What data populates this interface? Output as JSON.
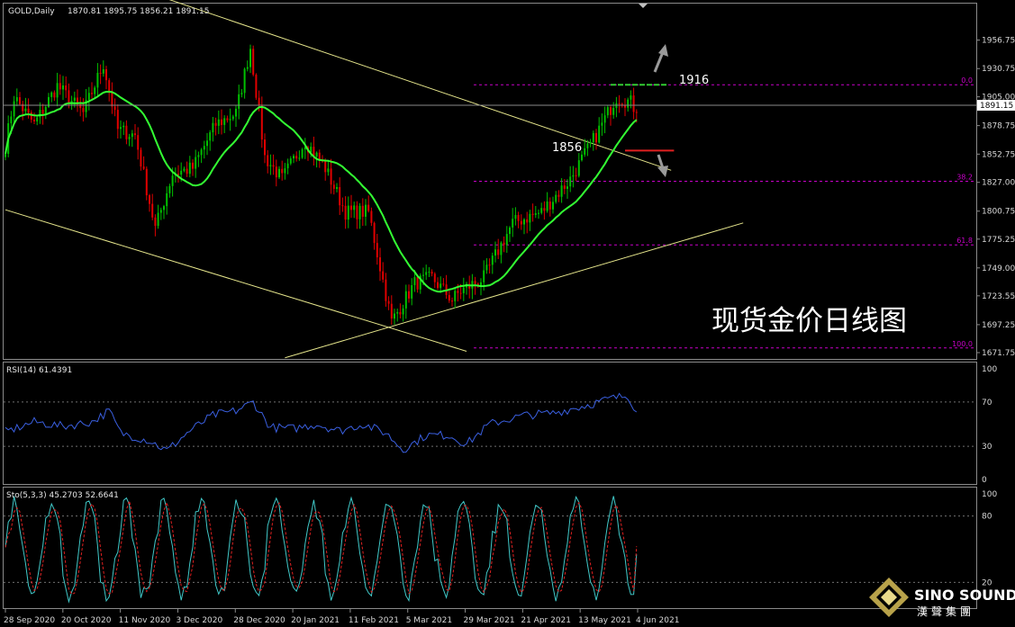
{
  "header": {
    "symbol": "GOLD,Daily",
    "ohlc": "1870.81 1895.75 1856.21 1891.15",
    "rsi_label": "RSI(14) 61.4391",
    "sto_label": "Sto(5,3,3) 45.2703 52.6641"
  },
  "annotations": {
    "level_high": "1916",
    "level_low": "1856",
    "caption": "现货金价日线图",
    "current_price_tag": "1891.15"
  },
  "fib_levels": [
    {
      "label": "0.0",
      "price": 1916
    },
    {
      "label": "38.2",
      "price": 1828
    },
    {
      "label": "61.8",
      "price": 1770
    },
    {
      "label": "100.0",
      "price": 1676
    }
  ],
  "logo": {
    "name": "SINO SOUND",
    "sub": "漢聲集團"
  },
  "colors": {
    "background": "#000000",
    "bull": "#00c000",
    "bear": "#e00000",
    "ma": "#33ff33",
    "trend": "#e6e68c",
    "fib": "#c800c8",
    "rsi": "#3a5fe0",
    "sto_main": "#40c8c8",
    "sto_signal": "#e02020",
    "arrow": "#9a9a9a",
    "marker_green": "#33cc33",
    "marker_red": "#e02020"
  },
  "chart_data": [
    {
      "type": "line",
      "title": "GOLD,Daily",
      "y_ticks": [
        "1956.75",
        "1930.75",
        "1905.00",
        "1878.75",
        "1852.75",
        "1827.00",
        "1800.75",
        "1775.25",
        "1749.00",
        "1723.55",
        "1697.25",
        "1671.75"
      ],
      "ylim": [
        1666,
        1990
      ],
      "x_ticks": [
        "28 Sep 2020",
        "20 Oct 2020",
        "11 Nov 2020",
        "3 Dec 2020",
        "28 Dec 2020",
        "20 Jan 2021",
        "11 Feb 2021",
        "5 Mar 2021",
        "29 Mar 2021",
        "21 Apr 2021",
        "13 May 2021",
        "4 Jun 2021"
      ],
      "x_index_range": [
        0,
        175
      ],
      "close_keypoints": [
        {
          "i": 0,
          "v": 1860
        },
        {
          "i": 3,
          "v": 1905
        },
        {
          "i": 10,
          "v": 1880
        },
        {
          "i": 18,
          "v": 1915
        },
        {
          "i": 27,
          "v": 1890
        },
        {
          "i": 34,
          "v": 1935
        },
        {
          "i": 39,
          "v": 1875
        },
        {
          "i": 45,
          "v": 1870
        },
        {
          "i": 52,
          "v": 1785
        },
        {
          "i": 58,
          "v": 1835
        },
        {
          "i": 65,
          "v": 1840
        },
        {
          "i": 73,
          "v": 1880
        },
        {
          "i": 80,
          "v": 1890
        },
        {
          "i": 85,
          "v": 1950
        },
        {
          "i": 90,
          "v": 1850
        },
        {
          "i": 96,
          "v": 1830
        },
        {
          "i": 104,
          "v": 1865
        },
        {
          "i": 111,
          "v": 1840
        },
        {
          "i": 118,
          "v": 1800
        },
        {
          "i": 126,
          "v": 1800
        },
        {
          "i": 134,
          "v": 1700
        },
        {
          "i": 142,
          "v": 1735
        },
        {
          "i": 148,
          "v": 1740
        },
        {
          "i": 155,
          "v": 1720
        },
        {
          "i": 158,
          "v": 1728
        },
        {
          "i": 166,
          "v": 1740
        },
        {
          "i": 176,
          "v": 1790
        },
        {
          "i": 186,
          "v": 1800
        },
        {
          "i": 196,
          "v": 1830
        },
        {
          "i": 205,
          "v": 1870
        },
        {
          "i": 212,
          "v": 1905
        },
        {
          "i": 217,
          "v": 1900
        },
        {
          "i": 219,
          "v": 1891
        }
      ],
      "moving_average": true,
      "trend_lines": [
        {
          "from": {
            "i": 0,
            "v": 1802
          },
          "to": {
            "i": 160,
            "v": 1673
          }
        },
        {
          "from": {
            "i": 52,
            "v": 1998
          },
          "to": {
            "i": 231,
            "v": 1838
          }
        },
        {
          "from": {
            "i": 97,
            "v": 1667
          },
          "to": {
            "i": 256,
            "v": 1790
          }
        }
      ],
      "markers": [
        {
          "name": "high-marker",
          "from_i": 210,
          "to_i": 230,
          "v": 1916
        },
        {
          "name": "low-marker",
          "from_i": 215,
          "to_i": 232,
          "v": 1856
        }
      ]
    },
    {
      "type": "line",
      "title": "RSI(14) 61.4391",
      "y_ticks": [
        "100",
        "70",
        "30",
        "0"
      ],
      "ylim": [
        0,
        100
      ],
      "series": [
        {
          "name": "RSI(14)",
          "keypoints": [
            {
              "i": 0,
              "v": 43
            },
            {
              "i": 10,
              "v": 52
            },
            {
              "i": 20,
              "v": 48
            },
            {
              "i": 30,
              "v": 52
            },
            {
              "i": 36,
              "v": 62
            },
            {
              "i": 40,
              "v": 42
            },
            {
              "i": 50,
              "v": 35
            },
            {
              "i": 56,
              "v": 26
            },
            {
              "i": 64,
              "v": 44
            },
            {
              "i": 72,
              "v": 58
            },
            {
              "i": 80,
              "v": 62
            },
            {
              "i": 86,
              "v": 70
            },
            {
              "i": 92,
              "v": 47
            },
            {
              "i": 100,
              "v": 46
            },
            {
              "i": 108,
              "v": 50
            },
            {
              "i": 116,
              "v": 44
            },
            {
              "i": 124,
              "v": 50
            },
            {
              "i": 132,
              "v": 42
            },
            {
              "i": 138,
              "v": 27
            },
            {
              "i": 146,
              "v": 40
            },
            {
              "i": 154,
              "v": 40
            },
            {
              "i": 160,
              "v": 32
            },
            {
              "i": 168,
              "v": 50
            },
            {
              "i": 180,
              "v": 58
            },
            {
              "i": 190,
              "v": 60
            },
            {
              "i": 200,
              "v": 66
            },
            {
              "i": 210,
              "v": 73
            },
            {
              "i": 216,
              "v": 76
            },
            {
              "i": 218,
              "v": 66
            },
            {
              "i": 219,
              "v": 61
            }
          ]
        }
      ]
    },
    {
      "type": "line",
      "title": "Sto(5,3,3) 45.2703 52.6641",
      "y_ticks": [
        "100",
        "80",
        "20"
      ],
      "ylim": [
        0,
        100
      ],
      "series": [
        {
          "name": "Sto main",
          "cycle": 13,
          "last": 45.27
        },
        {
          "name": "Sto signal",
          "cycle": 13,
          "last": 52.66
        }
      ]
    }
  ]
}
